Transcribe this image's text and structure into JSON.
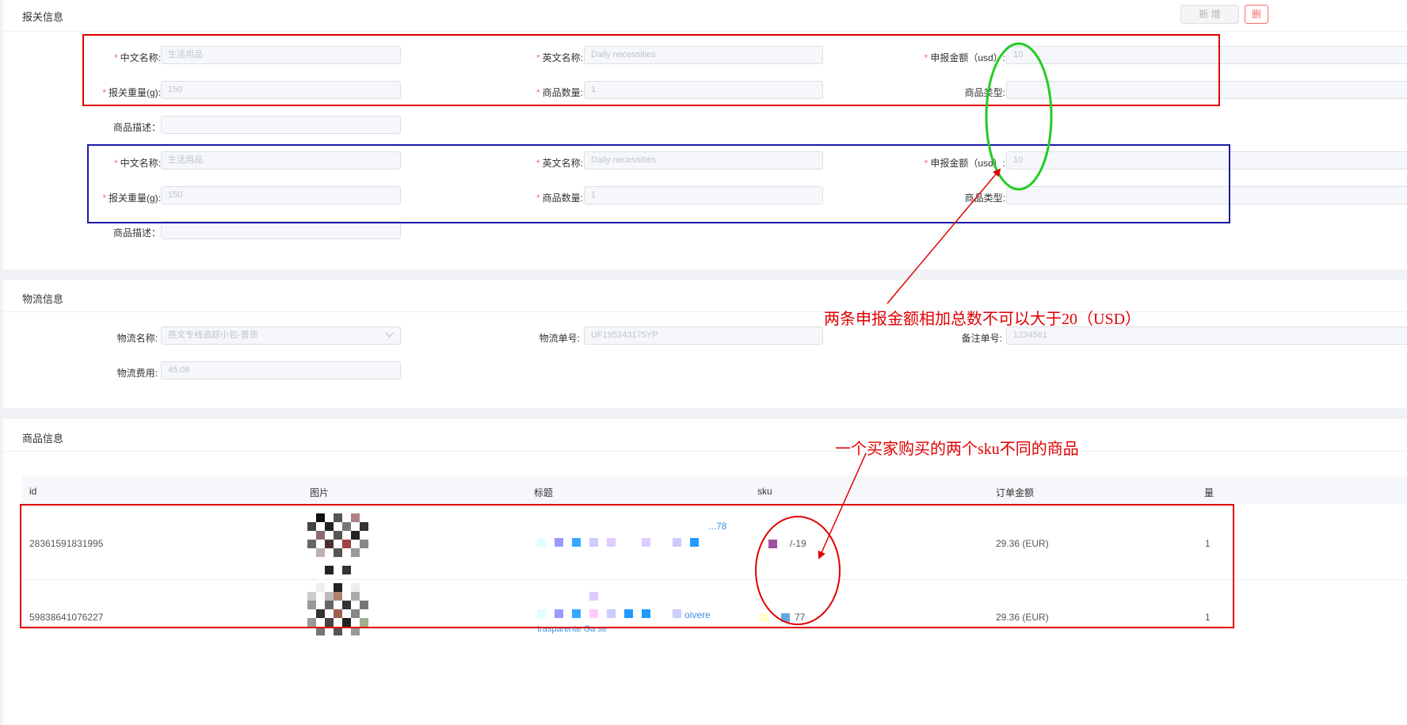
{
  "customs": {
    "title": "报关信息",
    "add_label": "新 增",
    "delete_label": "删",
    "items": [
      {
        "cn_name_label": "中文名称:",
        "cn_name": "生活用品",
        "en_name_label": "英文名称:",
        "en_name": "Daily necessities",
        "amount_label": "申报金额（usd）:",
        "amount": "10",
        "weight_label": "报关重量(g):",
        "weight": "150",
        "qty_label": "商品数量:",
        "qty": "1",
        "type_label": "商品类型:",
        "type": "",
        "desc_label": "商品描述：",
        "desc": ""
      },
      {
        "cn_name_label": "中文名称:",
        "cn_name": "生活用品",
        "en_name_label": "英文名称:",
        "en_name": "Daily necessities",
        "amount_label": "申报金额（usd）:",
        "amount": "10",
        "weight_label": "报关重量(g):",
        "weight": "150",
        "qty_label": "商品数量:",
        "qty": "1",
        "type_label": "商品类型:",
        "type": "",
        "desc_label": "商品描述：",
        "desc": ""
      }
    ]
  },
  "logistics": {
    "title": "物流信息",
    "name_label": "物流名称:",
    "name": "燕文专线追踪小包-普货",
    "tracking_label": "物流单号:",
    "tracking": "UF195243175YP",
    "remark_label": "备注单号:",
    "remark": "1234561",
    "fee_label": "物流费用:",
    "fee": "45.08"
  },
  "products": {
    "title": "商品信息",
    "columns": [
      "id",
      "图片",
      "标题",
      "sku",
      "订单金额",
      "量"
    ],
    "rows": [
      {
        "id": "28361591831995",
        "title_partial": "...78",
        "sku_partial": "/-19",
        "amount": "29.36 (EUR)",
        "qty": "1"
      },
      {
        "id": "59838641076227",
        "title_partial": "oivere",
        "title_line2": "trasparente Ga se",
        "sku_partial": "77",
        "amount": "29.36 (EUR)",
        "qty": "1"
      }
    ]
  },
  "annotations": {
    "sum_note": "两条申报金额相加总数不可以大于20（USD）",
    "sku_note": "一个买家购买的两个sku不同的商品",
    "colors": {
      "red": "#e00000",
      "blue": "#1a1aa8",
      "green": "#22cc22"
    }
  }
}
